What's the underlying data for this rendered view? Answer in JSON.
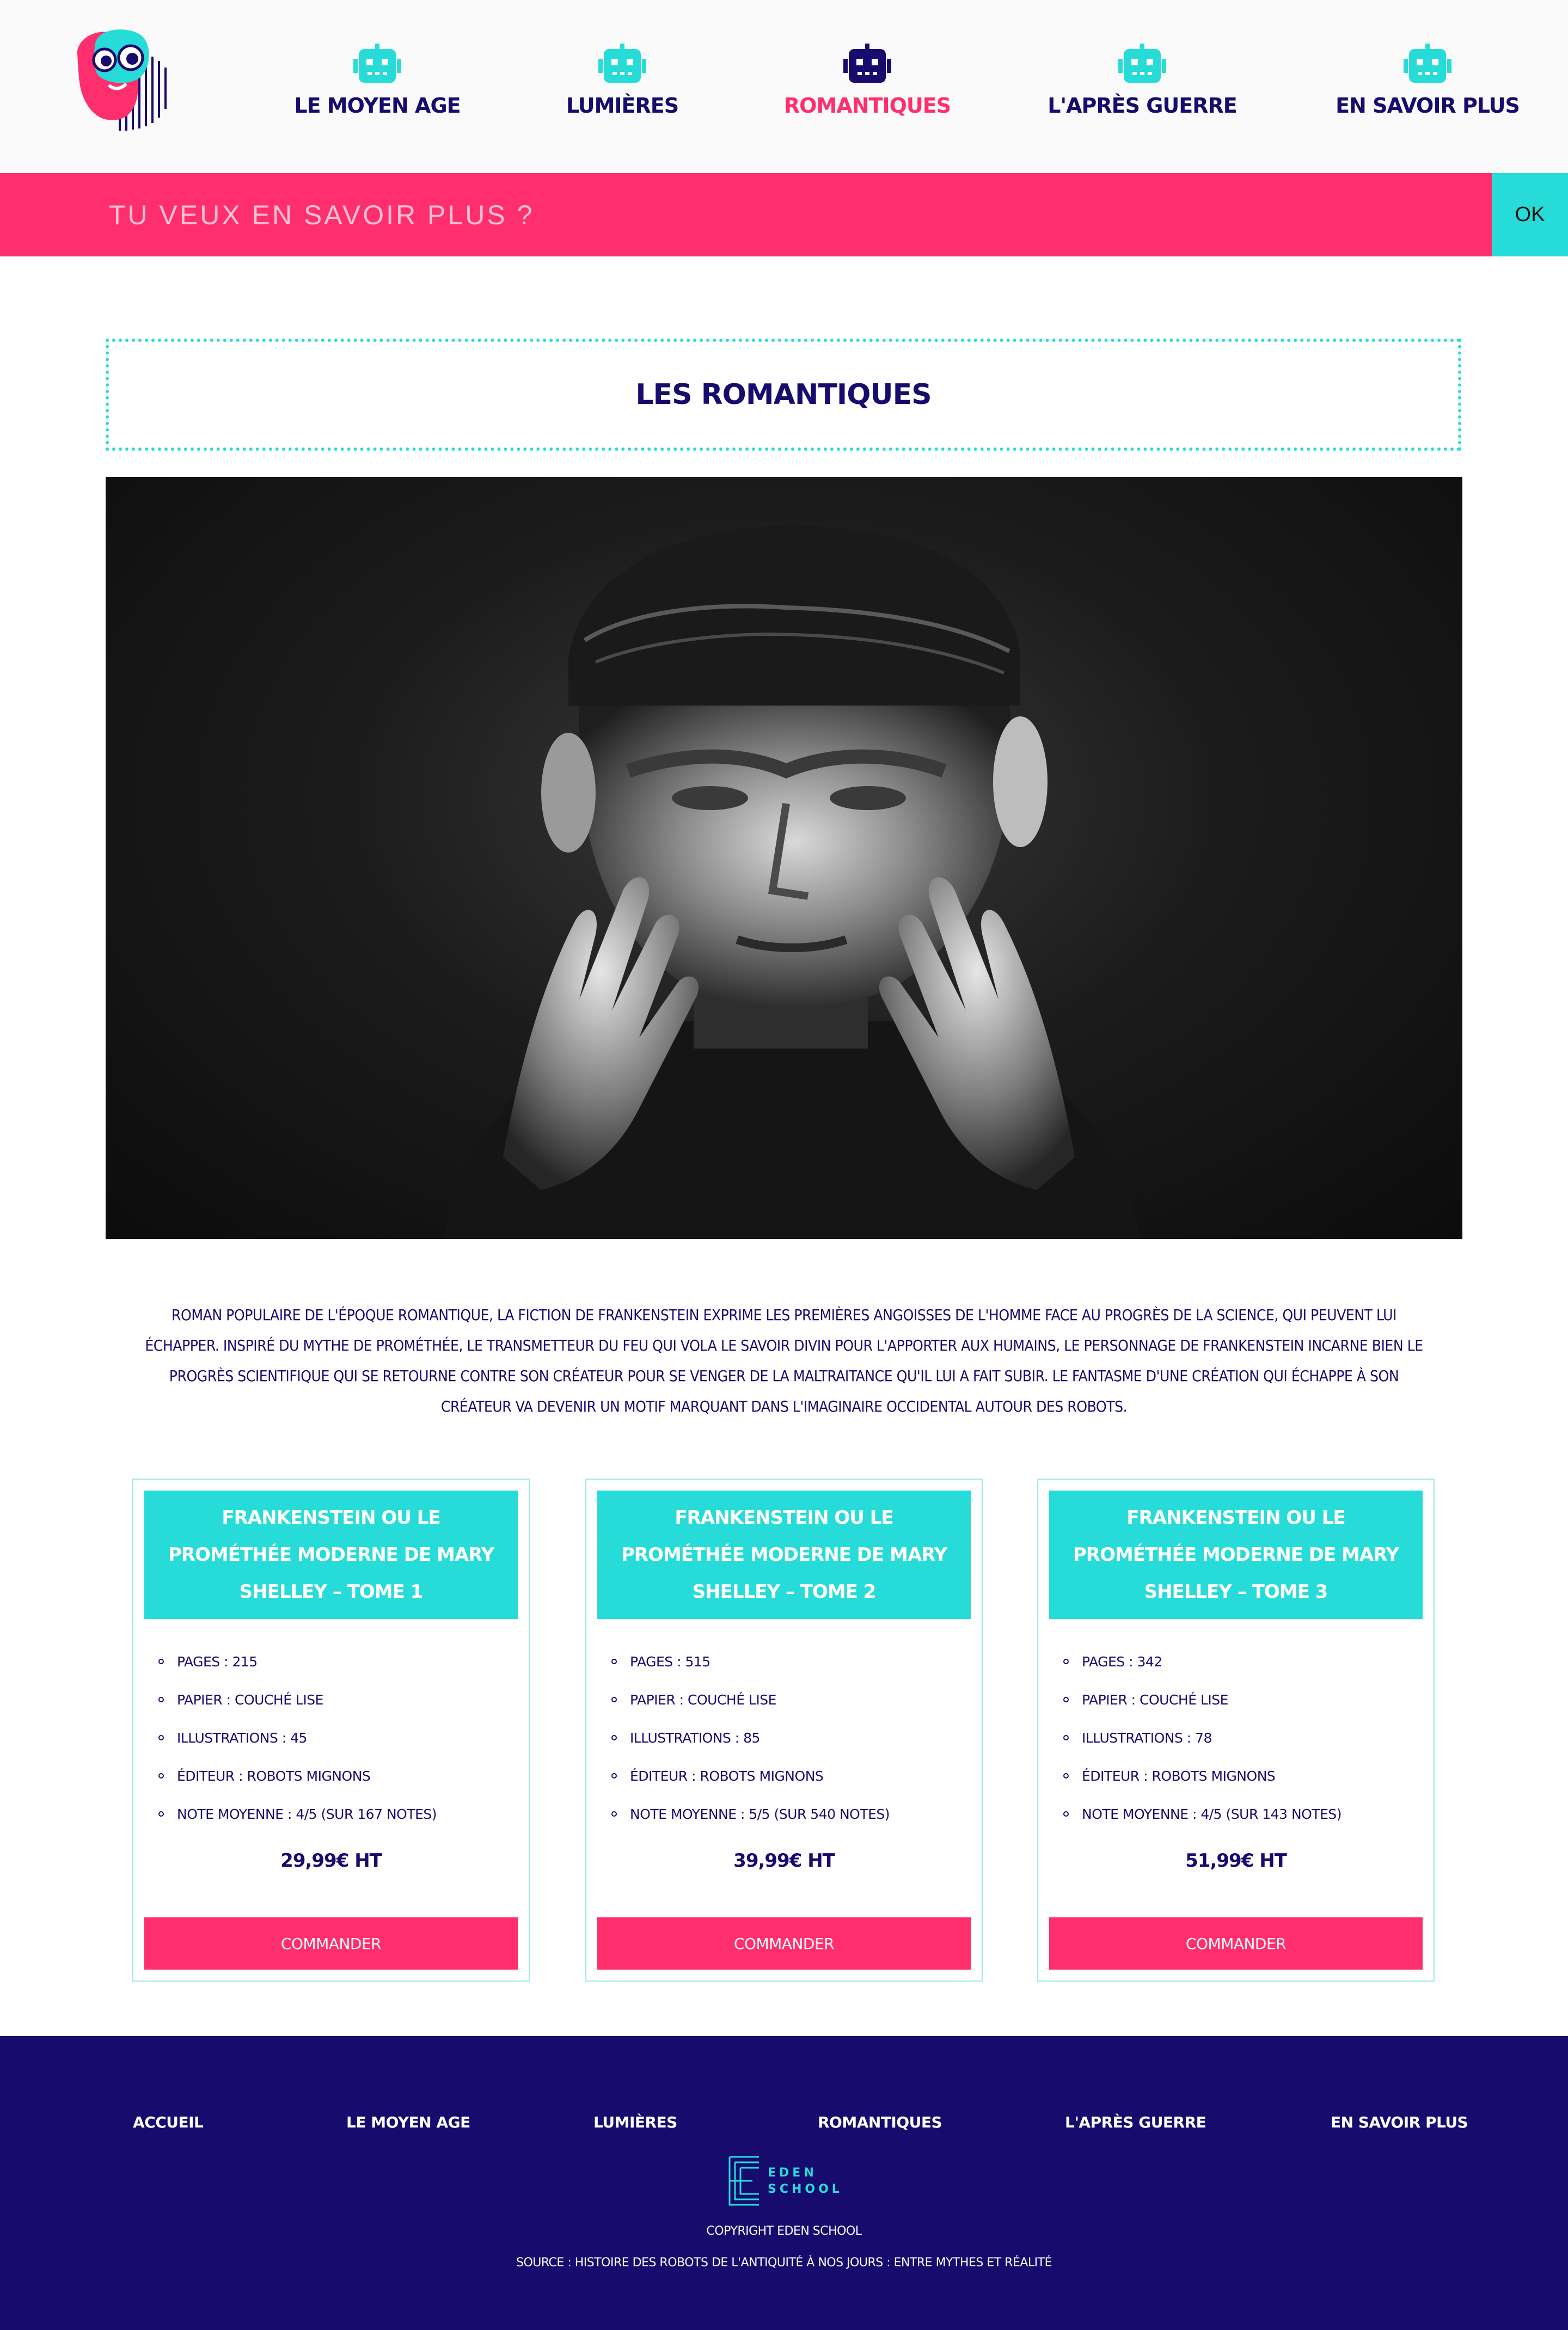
{
  "colors": {
    "navy": "#170b6e",
    "pink": "#ff2e6c",
    "turquoise": "#27dcd8",
    "header_bg": "#fafafa"
  },
  "header": {
    "logo_icon": "robot-face-logo",
    "nav": [
      {
        "label": "LE MOYEN AGE",
        "icon": "robot-icon",
        "active": false
      },
      {
        "label": "LUMIÈRES",
        "icon": "robot-icon",
        "active": false
      },
      {
        "label": "ROMANTIQUES",
        "icon": "robot-icon",
        "active": true
      },
      {
        "label": "L'APRÈS GUERRE",
        "icon": "robot-icon",
        "active": false
      },
      {
        "label": "EN SAVOIR PLUS",
        "icon": "robot-icon",
        "active": false
      }
    ]
  },
  "banner": {
    "placeholder": "TU VEUX EN SAVOIR PLUS ?",
    "button_label": "OK"
  },
  "main": {
    "title": "LES ROMANTIQUES",
    "hero_icon": "frankenstein-photo",
    "description": "Roman populaire de l'époque romantique, la fiction de Frankenstein exprime les premières angoisses de l'homme face au progrès de la science, qui peuvent lui échapper. Inspiré du mythe de Prométhée, le transmetteur du feu qui vola le savoir divin pour l'apporter aux humains, le personnage de Frankenstein incarne bien le progrès scientifique qui se retourne contre son créateur pour se venger de la maltraitance qu'il lui a fait subir. Le fantasme d'une création qui échappe à son créateur va devenir un motif marquant dans l'imaginaire occidental autour des robots."
  },
  "cards": [
    {
      "title": "FRANKENSTEIN OU LE PROMÉTHÉE MODERNE DE MARY SHELLEY – TOME 1",
      "specs": [
        "PAGES : 215",
        "PAPIER : COUCHÉ LISE",
        "ILLUSTRATIONS : 45",
        "ÉDITEUR : ROBOTS MIGNONS",
        "NOTE MOYENNE : 4/5 (SUR 167 NOTES)"
      ],
      "price": "29,99€ HT",
      "button": "COMMANDER"
    },
    {
      "title": "FRANKENSTEIN OU LE PROMÉTHÉE MODERNE DE MARY SHELLEY – TOME 2",
      "specs": [
        "PAGES : 515",
        "PAPIER : COUCHÉ LISE",
        "ILLUSTRATIONS : 85",
        "ÉDITEUR : ROBOTS MIGNONS",
        "NOTE MOYENNE : 5/5 (SUR 540 NOTES)"
      ],
      "price": "39,99€ HT",
      "button": "COMMANDER"
    },
    {
      "title": "FRANKENSTEIN OU LE PROMÉTHÉE MODERNE DE MARY SHELLEY – TOME 3",
      "specs": [
        "PAGES : 342",
        "PAPIER : COUCHÉ LISE",
        "ILLUSTRATIONS : 78",
        "ÉDITEUR : ROBOTS MIGNONS",
        "NOTE MOYENNE : 4/5 (SUR 143 NOTES)"
      ],
      "price": "51,99€ HT",
      "button": "COMMANDER"
    }
  ],
  "footer": {
    "links": [
      "ACCUEIL",
      "LE MOYEN AGE",
      "LUMIÈRES",
      "ROMANTIQUES",
      "L'APRÈS GUERRE",
      "EN SAVOIR PLUS"
    ],
    "logo_line1": "EDEN",
    "logo_line2": "SCHOOL",
    "copyright": "COPYRIGHT EDEN SCHOOL",
    "source": "SOURCE : HISTOIRE DES ROBOTS DE L'ANTIQUITÉ À NOS JOURS : ENTRE MYTHES ET RÉALITÉ"
  }
}
